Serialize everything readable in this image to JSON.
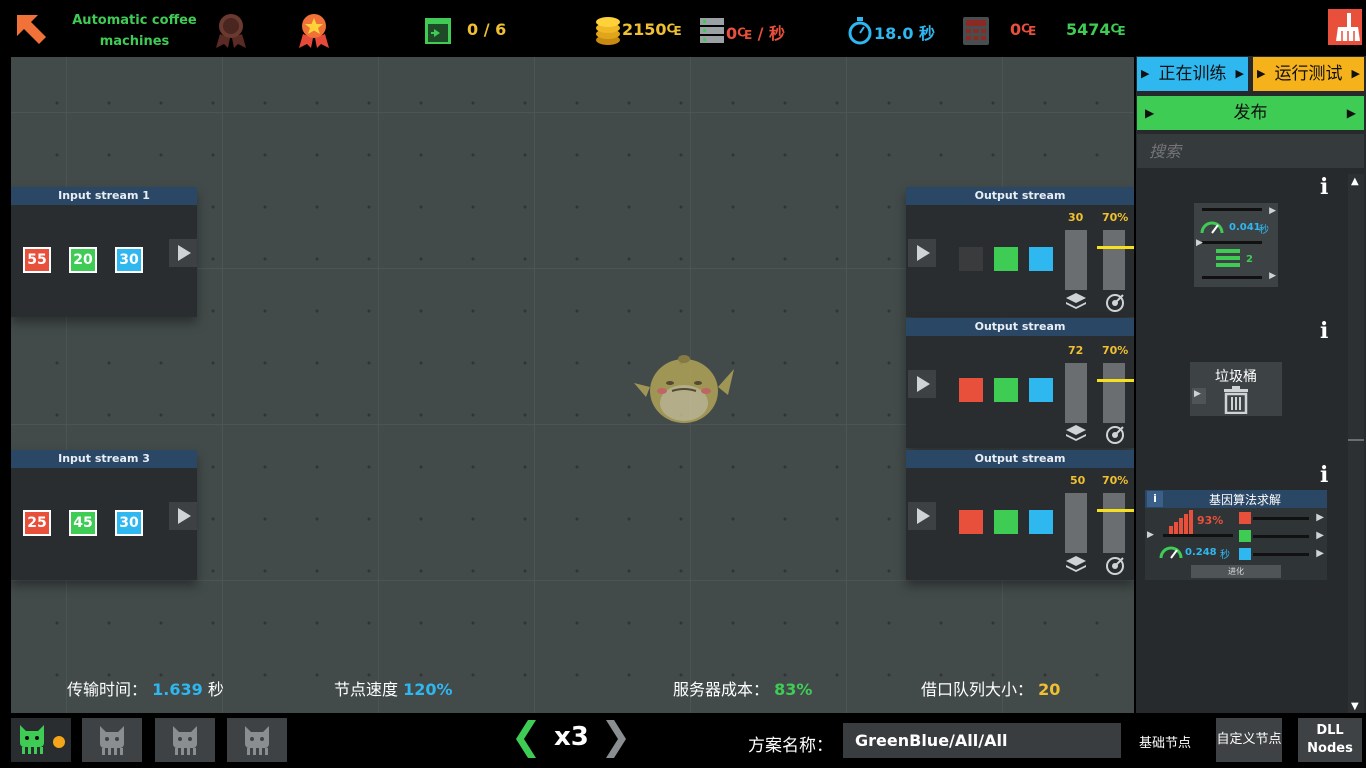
{
  "topbar": {
    "level_name": "Automatic coffee machines",
    "tasks": "0 / 6",
    "money": "2150₠",
    "income": "0₠ / 秒",
    "time": "18.0 秒",
    "cost": "0₠",
    "score": "5474₠"
  },
  "input_nodes": [
    {
      "title": "Input stream 1",
      "values": [
        "55",
        "20",
        "30"
      ]
    },
    {
      "title": "Input stream 3",
      "values": [
        "25",
        "45",
        "30"
      ]
    }
  ],
  "output_nodes": [
    {
      "title": "Output stream",
      "count": "30",
      "percent": "70%"
    },
    {
      "title": "Output stream",
      "count": "72",
      "percent": "70%"
    },
    {
      "title": "Output stream",
      "count": "50",
      "percent": "70%"
    }
  ],
  "stats": {
    "transfer_label": "传输时间：",
    "transfer_value": "1.639",
    "transfer_unit": "秒",
    "speed_label": "节点速度",
    "speed_value": "120%",
    "server_label": "服务器成本：",
    "server_value": "83%",
    "queue_label": "借口队列大小：",
    "queue_value": "20"
  },
  "sidebar": {
    "training_label": "正在训练",
    "test_label": "运行测试",
    "publish_label": "发布",
    "search_placeholder": "搜索",
    "items": [
      {
        "speed": "0.041",
        "speed_unit": "秒",
        "count": "2"
      },
      {
        "label": "垃圾桶"
      },
      {
        "title": "基因算法求解",
        "percent": "93%",
        "speed": "0.248",
        "speed_unit": "秒",
        "button": "进化"
      }
    ],
    "tabs": [
      "基础节点",
      "自定义节点",
      "DLL Nodes"
    ]
  },
  "bottom": {
    "multiplier": "x3",
    "scheme_label": "方案名称：",
    "scheme_value": "GreenBlue/All/All"
  },
  "colors": {
    "accent_orange": "#f07238",
    "green": "#3fcc55",
    "yellow": "#f0c030",
    "blue": "#2fb7f0",
    "red": "#e8503c"
  },
  "icons": [
    "arrow-up-left-icon",
    "medal-icon",
    "star-medal-icon",
    "exit-door-icon",
    "coins-icon",
    "server-icon",
    "stopwatch-icon",
    "calculator-icon",
    "broom-icon",
    "trash-icon",
    "layers-icon",
    "target-icon",
    "speedometer-icon",
    "cat-icon"
  ]
}
